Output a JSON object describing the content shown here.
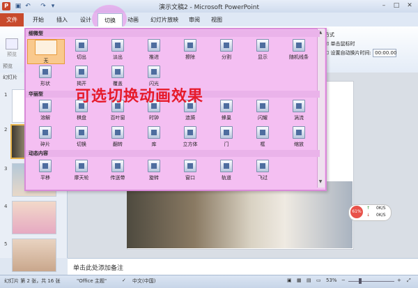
{
  "titlebar": {
    "app_icon": "P",
    "title": "演示文稿2 - Microsoft PowerPoint",
    "quick_access": [
      "save-icon",
      "undo-icon",
      "redo-icon",
      "customize-icon"
    ],
    "minimize": "–",
    "maximize": "□",
    "close": "✕"
  },
  "tabs": {
    "file": "文件",
    "items": [
      "开始",
      "插入",
      "设计",
      "切换",
      "动画",
      "幻灯片放映",
      "审阅",
      "视图"
    ]
  },
  "ribbon": {
    "preview": "预览",
    "preview_group": "预览",
    "right_group": {
      "title": "方式",
      "on_click": "单击鼠标时",
      "after_label": "设置自动换片时间:",
      "after_value": "00:00.00"
    }
  },
  "gallery": {
    "caption": "可选切换动画效果",
    "sections": [
      {
        "title": "细微型",
        "items": [
          "无",
          "切出",
          "淡出",
          "推进",
          "擦除",
          "分割",
          "显示",
          "随机线条",
          "形状",
          "揭开",
          "覆盖",
          "闪光"
        ]
      },
      {
        "title": "华丽型",
        "items": [
          "溶解",
          "棋盘",
          "百叶窗",
          "时钟",
          "涟漪",
          "蜂巢",
          "闪耀",
          "涡流",
          "碎片",
          "切换",
          "翻转",
          "库",
          "立方体",
          "门",
          "框",
          "缩放"
        ]
      },
      {
        "title": "动态内容",
        "items": [
          "平移",
          "摩天轮",
          "传送带",
          "旋转",
          "窗口",
          "轨道",
          "飞过"
        ]
      }
    ],
    "selected": "无"
  },
  "left_pane": {
    "tab": "幻灯片",
    "slide_numbers": [
      "1",
      "2",
      "3",
      "4",
      "5"
    ]
  },
  "notes": {
    "placeholder": "单击此处添加备注"
  },
  "speed_widget": {
    "percent": "61%",
    "up": "0K/S",
    "down": "0K/S"
  },
  "statusbar": {
    "slide_info": "幻灯片 第 2 张，共 16 张",
    "theme": "\"Office 主题\"",
    "language": "中文(中国)",
    "zoom": "53%"
  }
}
